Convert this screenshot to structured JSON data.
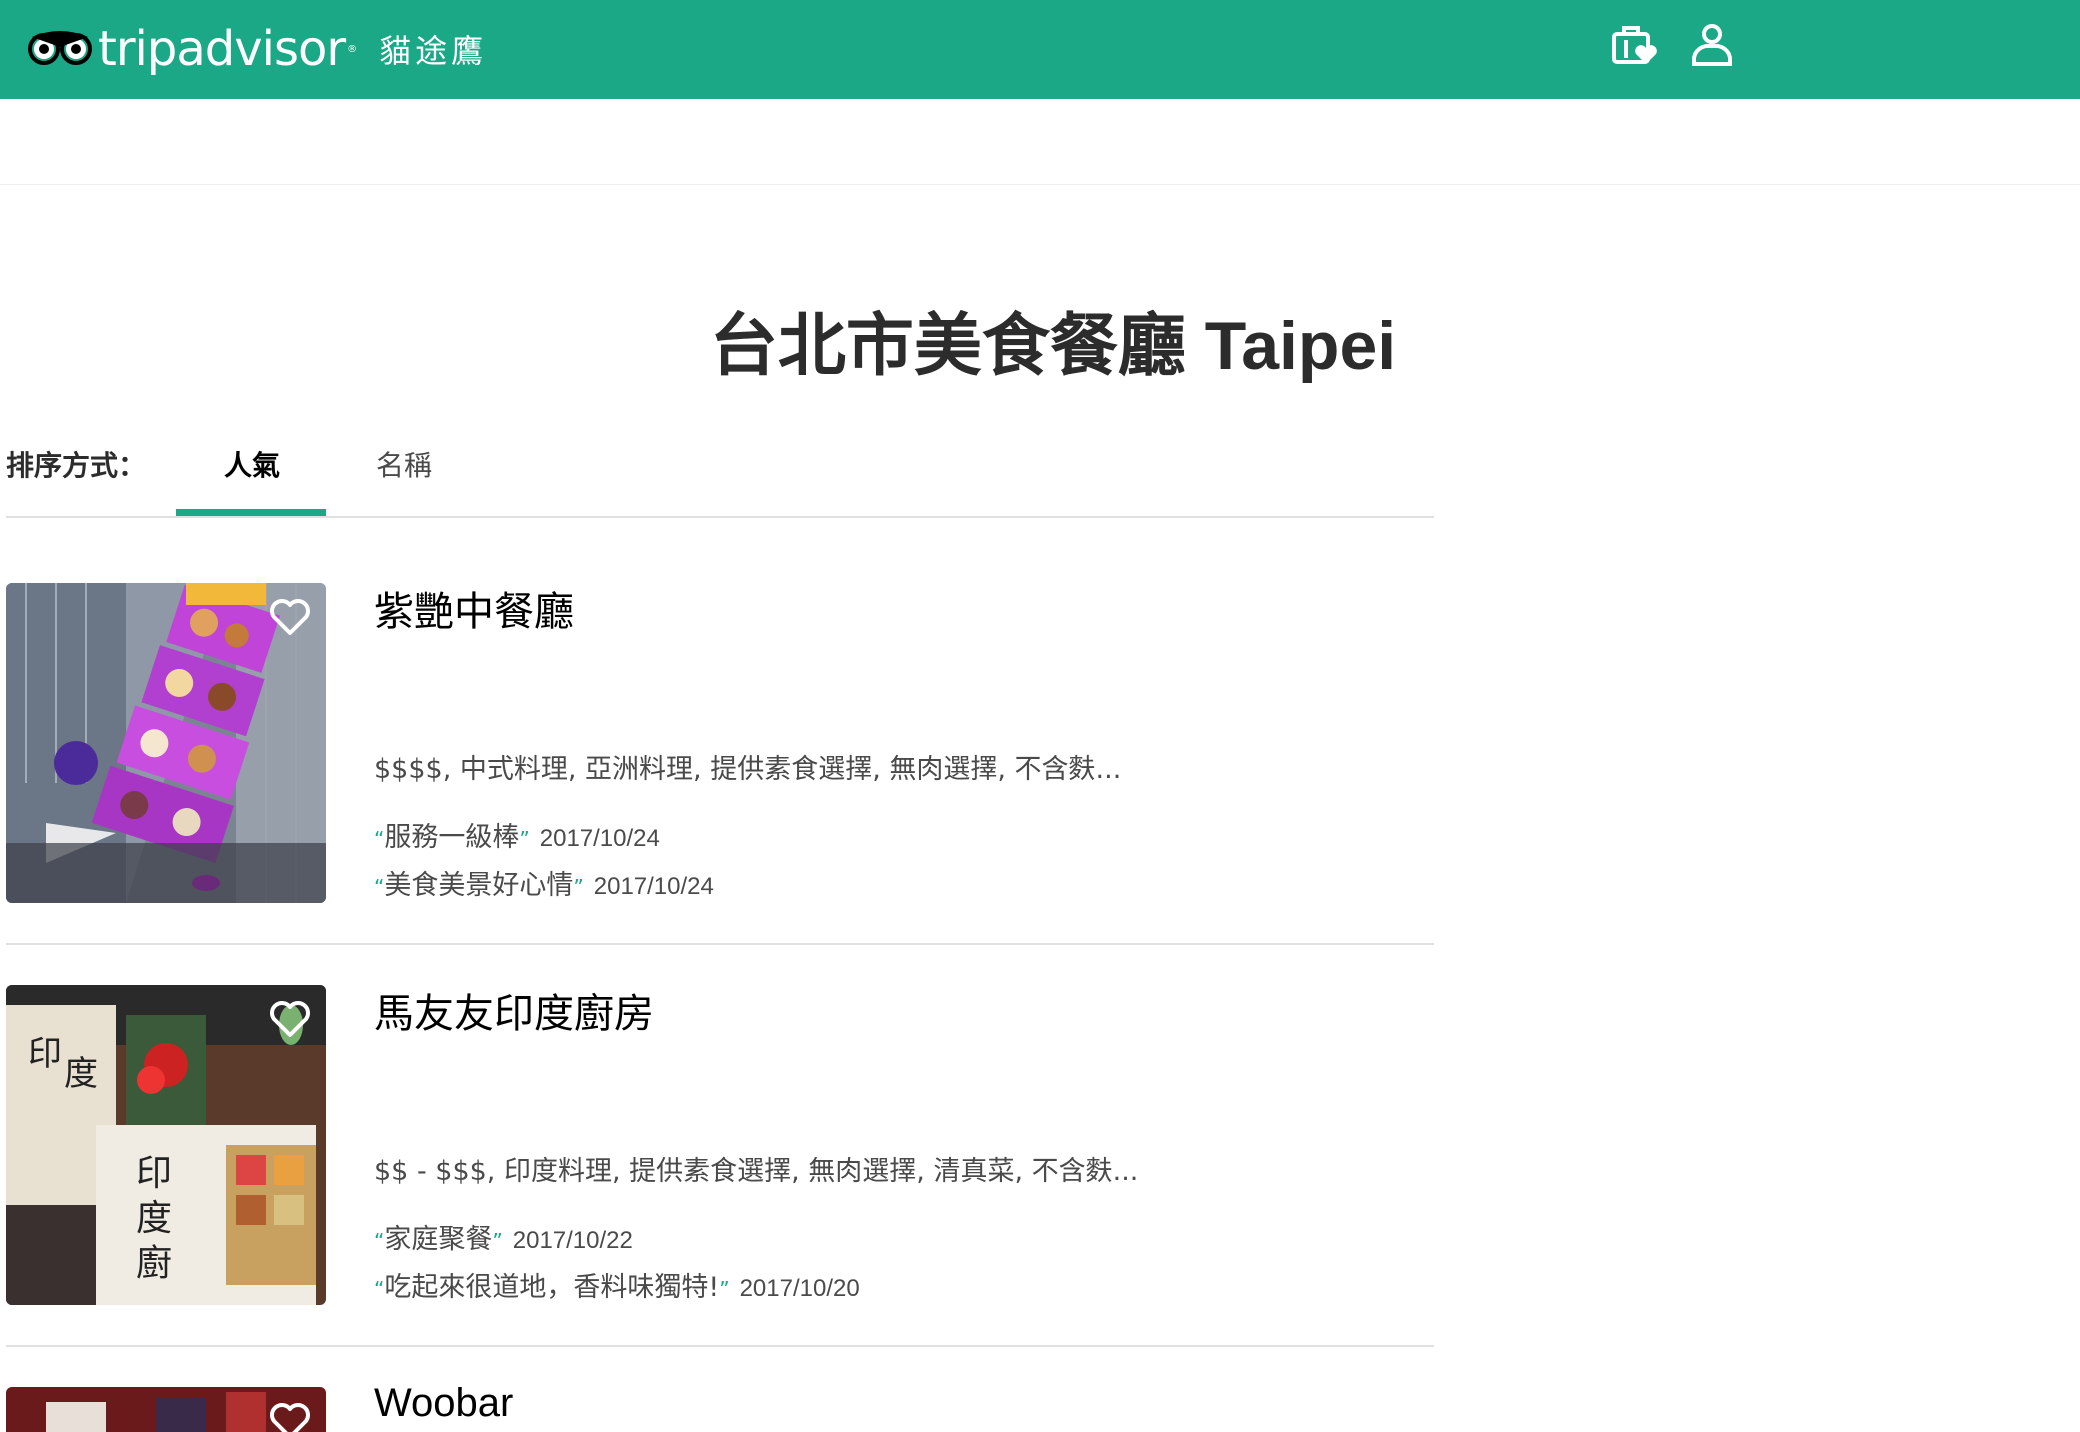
{
  "header": {
    "brand": "tripadvisor",
    "brand_zh": "貓途鷹",
    "brand_color": "#1aa886",
    "icons": [
      "owl-logo-icon",
      "trips-heart-icon",
      "user-icon"
    ]
  },
  "page": {
    "title": "台北市美食餐廳 Taipei"
  },
  "sort": {
    "label": "排序方式：",
    "options": [
      "人氣",
      "名稱"
    ],
    "selected": "人氣"
  },
  "listings": [
    {
      "name": "紫艷中餐廳",
      "cuisine": "$$$$, 中式料理, 亞洲料理, 提供素食選擇, 無肉選擇, 不含麩...",
      "reviews": [
        {
          "open": "“",
          "text": "服務一級棒",
          "close": "”",
          "date": "2017/10/24"
        },
        {
          "open": "“",
          "text": "美食美景好心情",
          "close": "”",
          "date": "2017/10/24"
        }
      ]
    },
    {
      "name": "馬友友印度廚房",
      "cuisine": "$$ - $$$, 印度料理, 提供素食選擇, 無肉選擇, 清真菜, 不含麩...",
      "reviews": [
        {
          "open": "“",
          "text": "家庭聚餐",
          "close": "”",
          "date": "2017/10/22"
        },
        {
          "open": "“",
          "text": "吃起來很道地，香料味獨特!",
          "close": "”",
          "date": "2017/10/20"
        }
      ]
    },
    {
      "name": "Woobar"
    }
  ]
}
